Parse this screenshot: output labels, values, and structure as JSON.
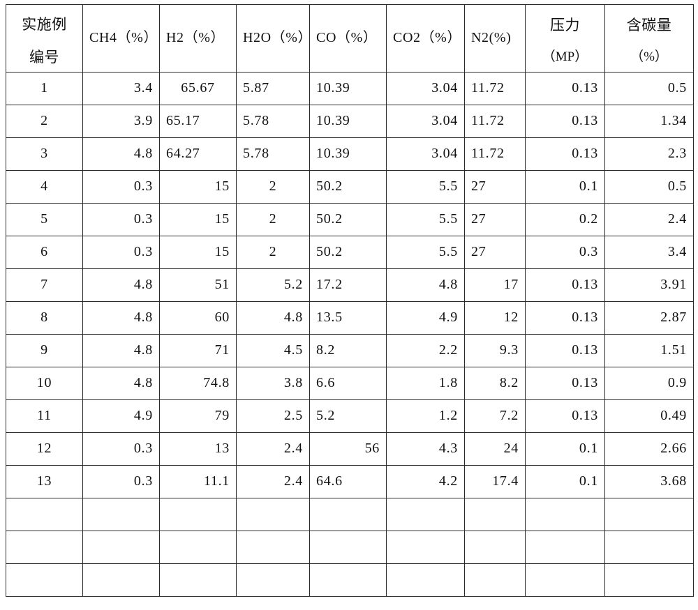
{
  "table": {
    "columns": [
      {
        "key": "index",
        "line1": "实施例",
        "line2": "编号",
        "style": "cjk"
      },
      {
        "key": "ch4",
        "line1": "CH4（%）",
        "line2": "",
        "style": "latin"
      },
      {
        "key": "h2",
        "line1": "H2（%）",
        "line2": "",
        "style": "latin"
      },
      {
        "key": "h2o",
        "line1": "H2O（%）",
        "line2": "",
        "style": "latin"
      },
      {
        "key": "co",
        "line1": "CO（%）",
        "line2": "",
        "style": "latin"
      },
      {
        "key": "co2",
        "line1": "CO2（%）",
        "line2": "",
        "style": "latin"
      },
      {
        "key": "n2",
        "line1": "N2(%)",
        "line2": "",
        "style": "latin"
      },
      {
        "key": "pressure",
        "line1": "压力",
        "line2": "（MP）",
        "style": "mixed"
      },
      {
        "key": "carbon",
        "line1": "含碳量",
        "line2": "（%）",
        "style": "mixed"
      }
    ],
    "rows": [
      {
        "index": "1",
        "ch4": "3.4",
        "h2": "65.67",
        "h2o": "5.87",
        "co": "10.39",
        "co2": "3.04",
        "n2": "11.72",
        "pressure": "0.13",
        "carbon": "0.5"
      },
      {
        "index": "2",
        "ch4": "3.9",
        "h2": "65.17",
        "h2o": "5.78",
        "co": "10.39",
        "co2": "3.04",
        "n2": "11.72",
        "pressure": "0.13",
        "carbon": "1.34"
      },
      {
        "index": "3",
        "ch4": "4.8",
        "h2": "64.27",
        "h2o": "5.78",
        "co": "10.39",
        "co2": "3.04",
        "n2": "11.72",
        "pressure": "0.13",
        "carbon": "2.3"
      },
      {
        "index": "4",
        "ch4": "0.3",
        "h2": "15",
        "h2o": "2",
        "co": "50.2",
        "co2": "5.5",
        "n2": "27",
        "pressure": "0.1",
        "carbon": "0.5"
      },
      {
        "index": "5",
        "ch4": "0.3",
        "h2": "15",
        "h2o": "2",
        "co": "50.2",
        "co2": "5.5",
        "n2": "27",
        "pressure": "0.2",
        "carbon": "2.4"
      },
      {
        "index": "6",
        "ch4": "0.3",
        "h2": "15",
        "h2o": "2",
        "co": "50.2",
        "co2": "5.5",
        "n2": "27",
        "pressure": "0.3",
        "carbon": "3.4"
      },
      {
        "index": "7",
        "ch4": "4.8",
        "h2": "51",
        "h2o": "5.2",
        "co": "17.2",
        "co2": "4.8",
        "n2": "17",
        "pressure": "0.13",
        "carbon": "3.91"
      },
      {
        "index": "8",
        "ch4": "4.8",
        "h2": "60",
        "h2o": "4.8",
        "co": "13.5",
        "co2": "4.9",
        "n2": "12",
        "pressure": "0.13",
        "carbon": "2.87"
      },
      {
        "index": "9",
        "ch4": "4.8",
        "h2": "71",
        "h2o": "4.5",
        "co": "8.2",
        "co2": "2.2",
        "n2": "9.3",
        "pressure": "0.13",
        "carbon": "1.51"
      },
      {
        "index": "10",
        "ch4": "4.8",
        "h2": "74.8",
        "h2o": "3.8",
        "co": "6.6",
        "co2": "1.8",
        "n2": "8.2",
        "pressure": "0.13",
        "carbon": "0.9"
      },
      {
        "index": "11",
        "ch4": "4.9",
        "h2": "79",
        "h2o": "2.5",
        "co": "5.2",
        "co2": "1.2",
        "n2": "7.2",
        "pressure": "0.13",
        "carbon": "0.49"
      },
      {
        "index": "12",
        "ch4": "0.3",
        "h2": "13",
        "h2o": "2.4",
        "co": "56",
        "co2": "4.3",
        "n2": "24",
        "pressure": "0.1",
        "carbon": "2.66"
      },
      {
        "index": "13",
        "ch4": "0.3",
        "h2": "11.1",
        "h2o": "2.4",
        "co": "64.6",
        "co2": "4.2",
        "n2": "17.4",
        "pressure": "0.1",
        "carbon": "3.68"
      }
    ],
    "empty_row_count": 3,
    "alignment": {
      "index": [
        "center",
        "center",
        "center",
        "center",
        "center",
        "center",
        "center",
        "center",
        "center",
        "center",
        "center",
        "center",
        "center"
      ],
      "ch4": [
        "right",
        "right",
        "right",
        "right",
        "right",
        "right",
        "right",
        "right",
        "right",
        "right",
        "right",
        "right",
        "right"
      ],
      "h2": [
        "center",
        "left",
        "left",
        "right",
        "right",
        "right",
        "right",
        "right",
        "right",
        "right",
        "right",
        "right",
        "right"
      ],
      "h2o": [
        "left",
        "left",
        "left",
        "center",
        "center",
        "center",
        "right",
        "right",
        "right",
        "right",
        "right",
        "right",
        "right"
      ],
      "co": [
        "left",
        "left",
        "left",
        "left",
        "left",
        "left",
        "left",
        "left",
        "left",
        "left",
        "left",
        "right",
        "left"
      ],
      "co2": [
        "right",
        "right",
        "right",
        "right",
        "right",
        "right",
        "right",
        "right",
        "right",
        "right",
        "right",
        "right",
        "right"
      ],
      "n2": [
        "left",
        "left",
        "left",
        "left",
        "left",
        "left",
        "right",
        "right",
        "right",
        "right",
        "right",
        "right",
        "right"
      ],
      "pressure": [
        "right",
        "right",
        "right",
        "right",
        "right",
        "right",
        "right",
        "right",
        "right",
        "right",
        "right",
        "right",
        "right"
      ],
      "carbon": [
        "right",
        "right",
        "right",
        "right",
        "right",
        "right",
        "right",
        "right",
        "right",
        "right",
        "right",
        "right",
        "right"
      ]
    }
  },
  "colors": {
    "page_background": "#ffffff",
    "grid_line": "#2b2b2b",
    "text": "#111111"
  }
}
